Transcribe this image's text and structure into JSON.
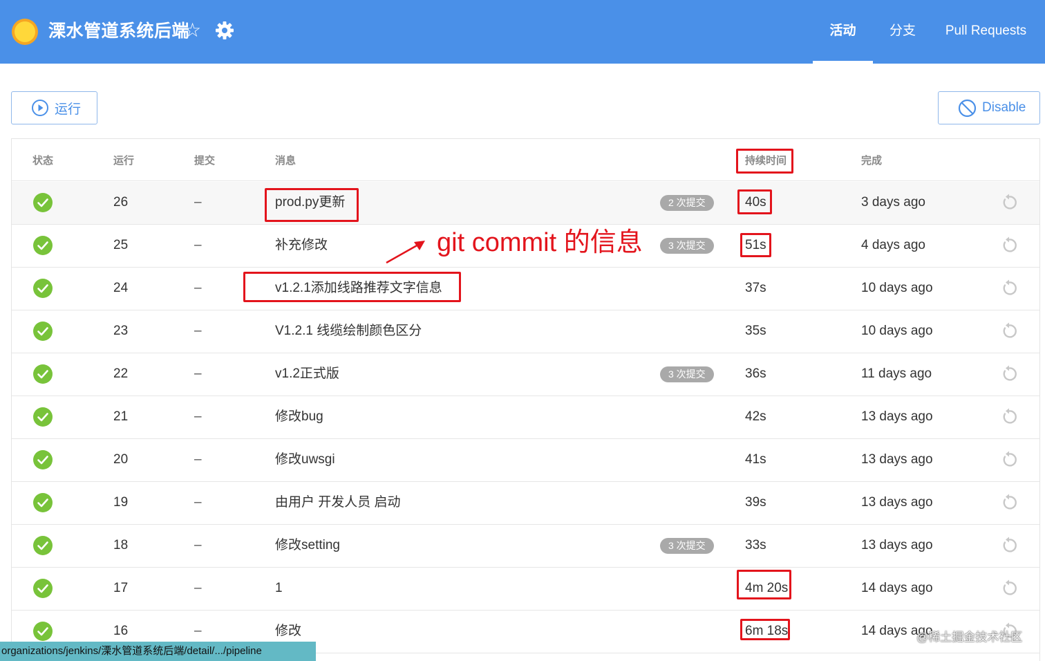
{
  "header": {
    "app_title": "溧水管道系统后端",
    "icons": [
      "sun-logo-icon",
      "star-icon",
      "gear-icon"
    ],
    "tabs": [
      {
        "label": "活动",
        "active": true
      },
      {
        "label": "分支",
        "active": false
      },
      {
        "label": "Pull Requests",
        "active": false
      }
    ]
  },
  "actions": {
    "run_label": "运行",
    "disable_label": "Disable"
  },
  "table": {
    "columns": [
      "状态",
      "运行",
      "提交",
      "消息",
      "持续时间",
      "完成"
    ],
    "rows": [
      {
        "status": "success",
        "run": "26",
        "commit": "–",
        "message": "prod.py更新",
        "badge": "2 次提交",
        "duration": "40s",
        "completed": "3 days ago"
      },
      {
        "status": "success",
        "run": "25",
        "commit": "–",
        "message": "补充修改",
        "badge": "3 次提交",
        "duration": "51s",
        "completed": "4 days ago"
      },
      {
        "status": "success",
        "run": "24",
        "commit": "–",
        "message": "v1.2.1添加线路推荐文字信息",
        "badge": "",
        "duration": "37s",
        "completed": "10 days ago"
      },
      {
        "status": "success",
        "run": "23",
        "commit": "–",
        "message": "V1.2.1 线缆绘制颜色区分",
        "badge": "",
        "duration": "35s",
        "completed": "10 days ago"
      },
      {
        "status": "success",
        "run": "22",
        "commit": "–",
        "message": "v1.2正式版",
        "badge": "3 次提交",
        "duration": "36s",
        "completed": "11 days ago"
      },
      {
        "status": "success",
        "run": "21",
        "commit": "–",
        "message": "修改bug",
        "badge": "",
        "duration": "42s",
        "completed": "13 days ago"
      },
      {
        "status": "success",
        "run": "20",
        "commit": "–",
        "message": "修改uwsgi",
        "badge": "",
        "duration": "41s",
        "completed": "13 days ago"
      },
      {
        "status": "success",
        "run": "19",
        "commit": "–",
        "message": "由用户 开发人员 启动",
        "badge": "",
        "duration": "39s",
        "completed": "13 days ago"
      },
      {
        "status": "success",
        "run": "18",
        "commit": "–",
        "message": "修改setting",
        "badge": "3 次提交",
        "duration": "33s",
        "completed": "13 days ago"
      },
      {
        "status": "success",
        "run": "17",
        "commit": "–",
        "message": "1",
        "badge": "",
        "duration": "4m 20s",
        "completed": "14 days ago"
      },
      {
        "status": "success",
        "run": "16",
        "commit": "–",
        "message": "修改",
        "badge": "",
        "duration": "6m 18s",
        "completed": "14 days ago"
      }
    ]
  },
  "annotation": {
    "text": "git commit 的信息",
    "color": "#e3141c"
  },
  "status_bar": {
    "url": "organizations/jenkins/溧水管道系统后端/detail/.../pipeline"
  },
  "watermark": "@稀土掘金技术社区",
  "colors": {
    "header": "#4a90e8",
    "success": "#78c33a",
    "badge": "#a9a9a9",
    "annotation_red": "#e3141c"
  }
}
